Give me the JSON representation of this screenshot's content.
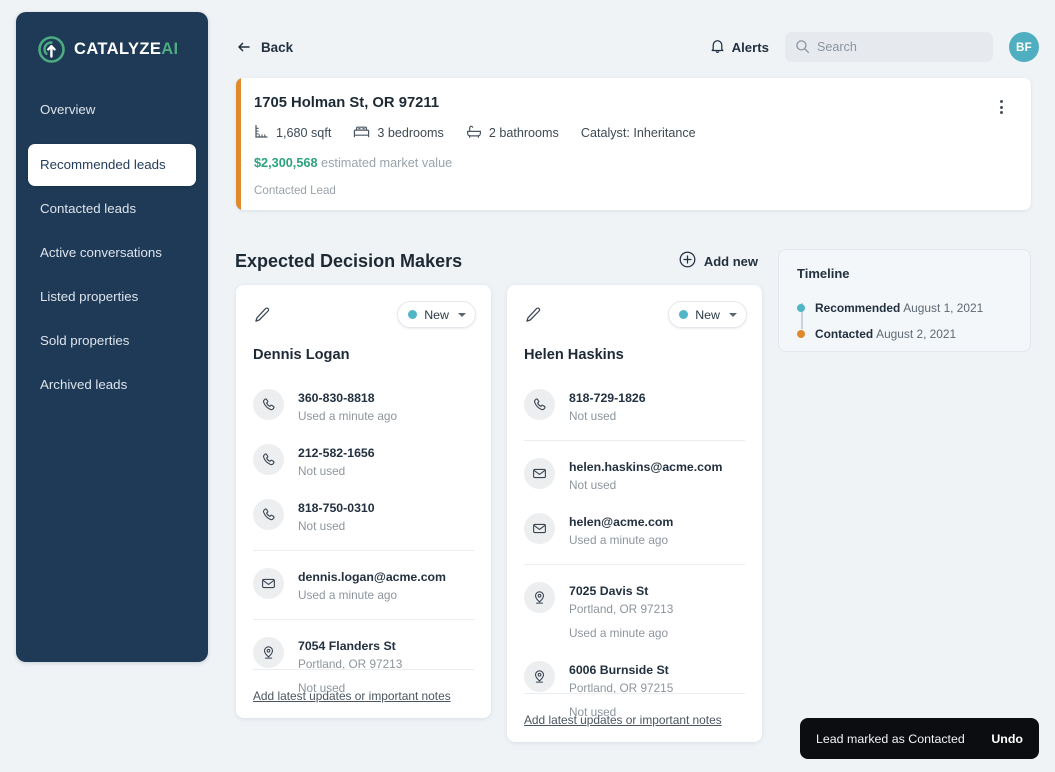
{
  "brand": {
    "name_main": "CATALYZE",
    "name_accent": "AI",
    "logo_icon": "catalyze-logo-icon"
  },
  "sidebar": {
    "items": [
      {
        "label": "Overview",
        "active": false
      },
      {
        "label": "Recommended leads",
        "active": true
      },
      {
        "label": "Contacted leads",
        "active": false
      },
      {
        "label": "Active conversations",
        "active": false
      },
      {
        "label": "Listed properties",
        "active": false
      },
      {
        "label": "Sold properties",
        "active": false
      },
      {
        "label": "Archived leads",
        "active": false
      }
    ]
  },
  "topbar": {
    "back_label": "Back",
    "back_icon": "arrow-left-icon",
    "alerts_label": "Alerts",
    "alerts_icon": "bell-icon",
    "search": {
      "placeholder": "Search",
      "value": "",
      "icon": "search-icon"
    },
    "avatar_initials": "BF"
  },
  "property": {
    "address": "1705 Holman St, OR 97211",
    "specs": [
      {
        "icon": "ruler-icon",
        "label": "1,680 sqft"
      },
      {
        "icon": "bed-icon",
        "label": "3 bedrooms"
      },
      {
        "icon": "bathtub-icon",
        "label": "2 bathrooms"
      }
    ],
    "catalyst": "Catalyst: Inheritance",
    "market_value": "$2,300,568",
    "market_value_label": "estimated market value",
    "status": "Contacted Lead",
    "menu_icon": "kebab-menu-icon",
    "accent_color": "#e08a2e",
    "value_color": "#2da37a"
  },
  "section": {
    "title": "Expected Decision Makers",
    "add_new_label": "Add new",
    "add_new_icon": "plus-circle-icon"
  },
  "contacts": [
    {
      "name": "Dennis Logan",
      "edit_icon": "pencil-icon",
      "status": {
        "label": "New",
        "dot_color": "#4fb5c7"
      },
      "note_link": "Add latest updates or important notes",
      "rows": [
        {
          "icon": "phone-icon",
          "value": "360-830-8818",
          "sub": "Used a minute ago",
          "sub2": "",
          "divider": false
        },
        {
          "icon": "phone-icon",
          "value": "212-582-1656",
          "sub": "Not used",
          "sub2": "",
          "divider": false
        },
        {
          "icon": "phone-icon",
          "value": "818-750-0310",
          "sub": "Not used",
          "sub2": "",
          "divider": false
        },
        {
          "icon": "mail-icon",
          "value": "dennis.logan@acme.com",
          "sub": "Used a minute ago",
          "sub2": "",
          "divider": true
        },
        {
          "icon": "map-pin-icon",
          "value": "7054 Flanders St",
          "sub": "Portland, OR 97213",
          "sub2": "Not used",
          "divider": true
        }
      ]
    },
    {
      "name": "Helen Haskins",
      "edit_icon": "pencil-icon",
      "status": {
        "label": "New",
        "dot_color": "#4fb5c7"
      },
      "note_link": "Add latest updates or important notes",
      "rows": [
        {
          "icon": "phone-icon",
          "value": "818-729-1826",
          "sub": "Not used",
          "sub2": "",
          "divider": false
        },
        {
          "icon": "mail-icon",
          "value": "helen.haskins@acme.com",
          "sub": "Not used",
          "sub2": "",
          "divider": true
        },
        {
          "icon": "mail-icon",
          "value": "helen@acme.com",
          "sub": "Used a minute ago",
          "sub2": "",
          "divider": false
        },
        {
          "icon": "map-pin-icon",
          "value": "7025 Davis St",
          "sub": "Portland, OR 97213",
          "sub2": "Used a minute ago",
          "divider": true
        },
        {
          "icon": "map-pin-icon",
          "value": "6006 Burnside St",
          "sub": "Portland, OR 97215",
          "sub2": "Not used",
          "divider": false
        }
      ]
    }
  ],
  "timeline": {
    "title": "Timeline",
    "events": [
      {
        "label": "Recommended",
        "date": "August 1, 2021",
        "color": "#4fb5c7"
      },
      {
        "label": "Contacted",
        "date": "August 2, 2021",
        "color": "#e08a2e"
      }
    ]
  },
  "toast": {
    "message": "Lead marked as Contacted",
    "action": "Undo"
  }
}
